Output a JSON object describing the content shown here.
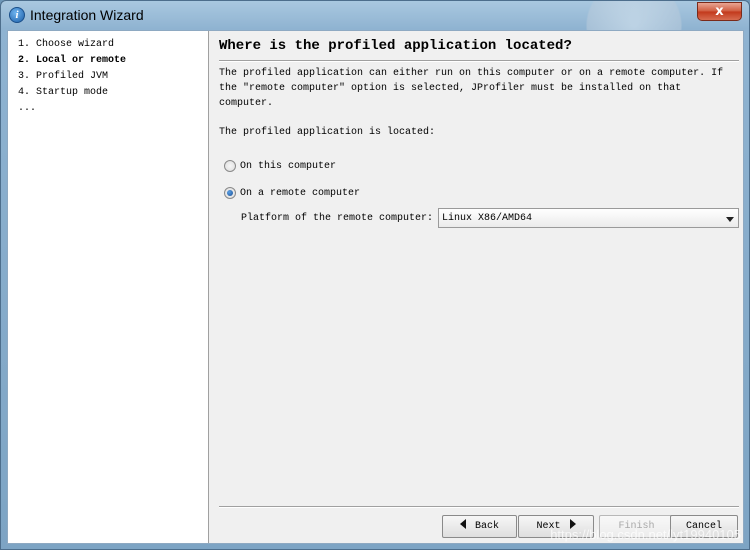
{
  "window": {
    "title": "Integration Wizard",
    "close_glyph": "x"
  },
  "steps": [
    {
      "label": "1. Choose wizard",
      "current": false
    },
    {
      "label": "2. Local or remote",
      "current": true
    },
    {
      "label": "3. Profiled JVM",
      "current": false
    },
    {
      "label": "4. Startup mode",
      "current": false
    },
    {
      "label": "...",
      "current": false
    }
  ],
  "main": {
    "heading": "Where is the profiled application located?",
    "description": "The profiled application can either run on this computer or on a remote computer. If the \"remote computer\" option is selected, JProfiler must be installed on that computer.",
    "located_label": "The profiled application is located:",
    "options": {
      "local": {
        "label": "On this computer",
        "checked": false
      },
      "remote": {
        "label": "On a remote computer",
        "checked": true
      }
    },
    "platform": {
      "label": "Platform of the remote computer:",
      "value": "Linux X86/AMD64"
    }
  },
  "buttons": {
    "back": {
      "label": "Back",
      "enabled": true
    },
    "next": {
      "label": "Next",
      "enabled": true
    },
    "finish": {
      "label": "Finish",
      "enabled": false
    },
    "cancel": {
      "label": "Cancel",
      "enabled": true
    }
  },
  "watermark": "https://blog.csdn.net/lyt19940105",
  "colors": {
    "title_bar": "#8fb3d1",
    "close_button": "#c2381b",
    "radio_selected": "#1b4f93"
  }
}
